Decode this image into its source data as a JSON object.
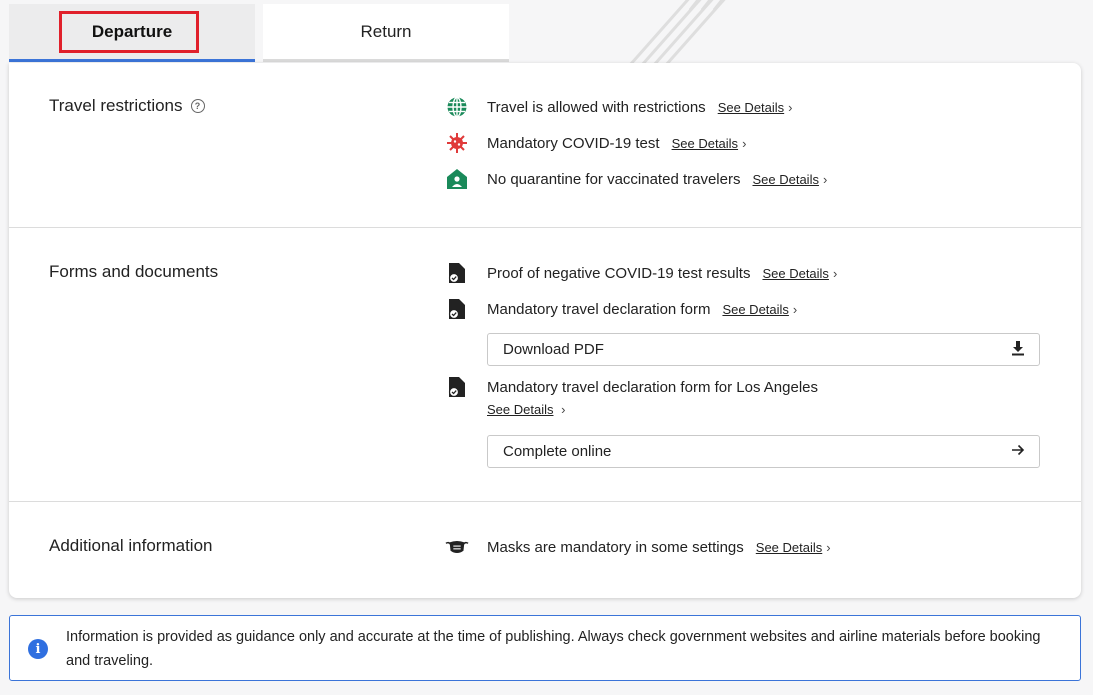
{
  "tabs": {
    "departure": "Departure",
    "return": "Return"
  },
  "sections": {
    "travel_restrictions": {
      "title": "Travel restrictions",
      "items": [
        {
          "text": "Travel is allowed with restrictions",
          "link": "See Details",
          "icon": "globe-icon"
        },
        {
          "text": "Mandatory COVID-19 test",
          "link": "See Details",
          "icon": "virus-icon"
        },
        {
          "text": "No quarantine for vaccinated travelers",
          "link": "See Details",
          "icon": "home-person-icon"
        }
      ]
    },
    "forms": {
      "title": "Forms and documents",
      "items": [
        {
          "text": "Proof of negative COVID-19 test results",
          "link": "See Details",
          "icon": "document-check-icon"
        },
        {
          "text": "Mandatory travel declaration form",
          "link": "See Details",
          "icon": "document-check-icon"
        },
        {
          "text": "Mandatory travel declaration form for Los Angeles",
          "link": "See Details",
          "icon": "document-check-icon"
        }
      ],
      "download_label": "Download PDF",
      "complete_label": "Complete online"
    },
    "additional": {
      "title": "Additional information",
      "items": [
        {
          "text": "Masks are mandatory in some settings",
          "link": "See Details",
          "icon": "mask-icon"
        }
      ]
    }
  },
  "notice": {
    "text": "Information is provided as guidance only and accurate at the time of publishing. Always check government websites and airline materials before booking and traveling."
  },
  "colors": {
    "accent": "#3b74d8",
    "highlight": "#e0202b",
    "green": "#1a8a5a",
    "red": "#e03a3a"
  }
}
